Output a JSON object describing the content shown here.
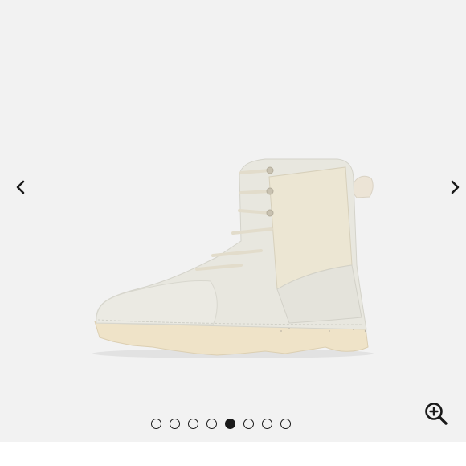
{
  "gallery": {
    "image_subject": "boot",
    "slide_count": 8,
    "active_index": 4,
    "prev_icon": "chevron-left-icon",
    "next_icon": "chevron-right-icon",
    "zoom_icon": "zoom-in-icon"
  },
  "colors": {
    "background": "#f2f2f2",
    "boot_upper": "#e6e5dc",
    "boot_sole": "#efe3c8",
    "icon": "#1a1a1a"
  }
}
